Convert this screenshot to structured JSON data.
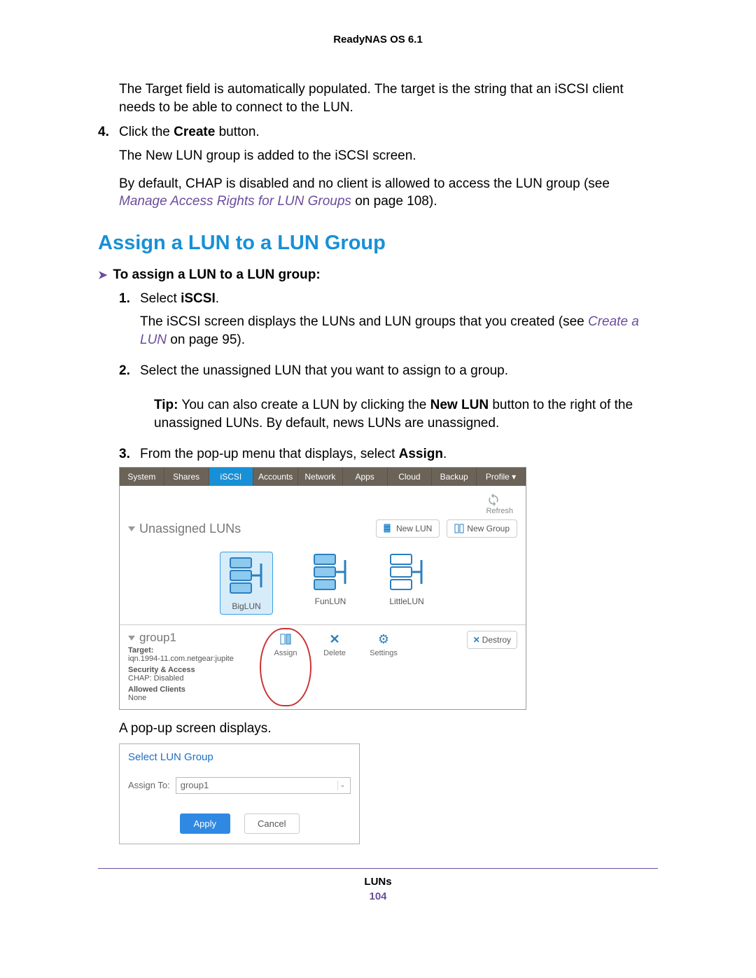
{
  "header": "ReadyNAS OS 6.1",
  "intro": "The Target field is automatically populated. The target is the string that an iSCSI client needs to be able to connect to the LUN.",
  "step4_pre": "Click the ",
  "step4_bold": "Create",
  "step4_post": " button.",
  "step4_res": "The New LUN group is added to the iSCSI screen.",
  "chap_pre": "By default, CHAP is disabled and no client is allowed to access the LUN group (see ",
  "chap_link": "Manage Access Rights for LUN Groups",
  "chap_post": " on page 108).",
  "h2": "Assign a LUN to a LUN Group",
  "proc_head": "To assign a LUN to a LUN group:",
  "s1_pre": "Select ",
  "s1_bold": "iSCSI",
  "s1_post": ".",
  "s1_res_pre": "The iSCSI screen displays the LUNs and LUN groups that you created (see ",
  "s1_res_link": "Create a LUN",
  "s1_res_post": " on page 95).",
  "s2": "Select the unassigned LUN that you want to assign to a group.",
  "tip_label": "Tip:",
  "tip_pre": " You can also create a LUN by clicking the ",
  "tip_bold": "New LUN",
  "tip_post": " button to the right of the unassigned LUNs. By default, news LUNs are unassigned.",
  "s3_pre": "From the pop-up menu that displays, select ",
  "s3_bold": "Assign",
  "s3_post": ".",
  "popup_text": "A pop-up screen displays.",
  "ss1": {
    "menu": [
      "System",
      "Shares",
      "iSCSI",
      "Accounts",
      "Network",
      "Apps",
      "Cloud",
      "Backup",
      "Profile ▾"
    ],
    "refresh": "Refresh",
    "unassigned": "Unassigned LUNs",
    "newlun": "New LUN",
    "newgroup": "New Group",
    "luns": [
      "BigLUN",
      "FunLUN",
      "LittleLUN"
    ],
    "group": "group1",
    "target_lbl": "Target:",
    "target_val": "iqn.1994-11.com.netgear:jupite",
    "sec_lbl": "Security & Access",
    "sec_val": "CHAP: Disabled",
    "clients_lbl": "Allowed Clients",
    "clients_val": "None",
    "assign": "Assign",
    "delete": "Delete",
    "settings": "Settings",
    "destroy": "Destroy"
  },
  "ss2": {
    "title": "Select LUN Group",
    "assign_to": "Assign To:",
    "value": "group1",
    "apply": "Apply",
    "cancel": "Cancel"
  },
  "footer_title": "LUNs",
  "footer_page": "104"
}
